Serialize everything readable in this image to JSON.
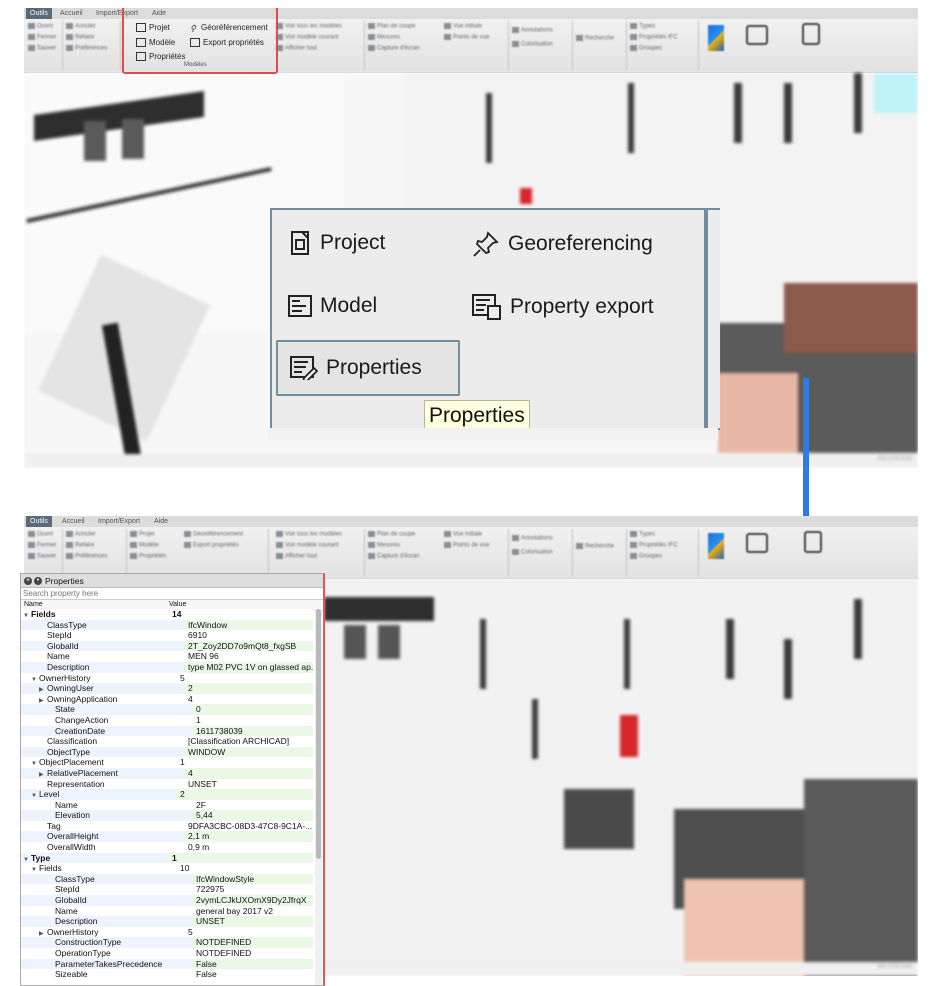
{
  "top_panel": {
    "tabs": [
      "Outils",
      "Accueil",
      "Import/Export",
      "Aide"
    ],
    "highlight_group": {
      "items": [
        "Projet",
        "Géoréférencement",
        "Modèle",
        "Export propriétés",
        "Propriétés"
      ],
      "group_label": "Modèles"
    }
  },
  "zoom": {
    "project": "Project",
    "georeferencing": "Georeferencing",
    "model": "Model",
    "property_export": "Property export",
    "properties": "Properties",
    "tooltip": "Properties"
  },
  "bottom_panel": {
    "tabs": [
      "Outils",
      "Accueil",
      "Import/Export",
      "Aide"
    ]
  },
  "properties_window": {
    "title": "Properties",
    "search_placeholder": "Search property here",
    "col_name": "Name",
    "col_value": "Value",
    "rows": [
      {
        "indent": 0,
        "toggle": "▼",
        "name": "Fields",
        "value": "14",
        "bold": true
      },
      {
        "indent": 2,
        "toggle": "",
        "name": "ClassType",
        "value": "IfcWindow"
      },
      {
        "indent": 2,
        "toggle": "",
        "name": "StepId",
        "value": "6910"
      },
      {
        "indent": 2,
        "toggle": "",
        "name": "GlobalId",
        "value": "2T_Zoy2DD7o9mQt8_fxgSB"
      },
      {
        "indent": 2,
        "toggle": "",
        "name": "Name",
        "value": "MEN 96"
      },
      {
        "indent": 2,
        "toggle": "",
        "name": "Description",
        "value": "type M02 PVC 1V on glassed ap..."
      },
      {
        "indent": 1,
        "toggle": "▼",
        "name": "OwnerHistory",
        "value": "5"
      },
      {
        "indent": 2,
        "toggle": "▶",
        "name": "OwningUser",
        "value": "2"
      },
      {
        "indent": 2,
        "toggle": "▶",
        "name": "OwningApplication",
        "value": "4"
      },
      {
        "indent": 3,
        "toggle": "",
        "name": "State",
        "value": "0"
      },
      {
        "indent": 3,
        "toggle": "",
        "name": "ChangeAction",
        "value": "1"
      },
      {
        "indent": 3,
        "toggle": "",
        "name": "CreationDate",
        "value": "1611738039"
      },
      {
        "indent": 2,
        "toggle": "",
        "name": "Classification",
        "value": "[Classification ARCHICAD]"
      },
      {
        "indent": 2,
        "toggle": "",
        "name": "ObjectType",
        "value": "WINDOW"
      },
      {
        "indent": 1,
        "toggle": "▼",
        "name": "ObjectPlacement",
        "value": "1"
      },
      {
        "indent": 2,
        "toggle": "▶",
        "name": "RelativePlacement",
        "value": "4"
      },
      {
        "indent": 2,
        "toggle": "",
        "name": "Representation",
        "value": "UNSET"
      },
      {
        "indent": 1,
        "toggle": "▼",
        "name": "Level",
        "value": "2"
      },
      {
        "indent": 3,
        "toggle": "",
        "name": "Name",
        "value": "2F"
      },
      {
        "indent": 3,
        "toggle": "",
        "name": "Elevation",
        "value": "5,44"
      },
      {
        "indent": 2,
        "toggle": "",
        "name": "Tag",
        "value": "9DFA3CBC-08D3-47C8-9C1A-..."
      },
      {
        "indent": 2,
        "toggle": "",
        "name": "OverallHeight",
        "value": "2,1 m"
      },
      {
        "indent": 2,
        "toggle": "",
        "name": "OverallWidth",
        "value": "0,9 m"
      },
      {
        "indent": 0,
        "toggle": "▼",
        "name": "Type",
        "value": "1",
        "bold": true
      },
      {
        "indent": 1,
        "toggle": "▼",
        "name": "Fields",
        "value": "10"
      },
      {
        "indent": 3,
        "toggle": "",
        "name": "ClassType",
        "value": "IfcWindowStyle"
      },
      {
        "indent": 3,
        "toggle": "",
        "name": "StepId",
        "value": "722975"
      },
      {
        "indent": 3,
        "toggle": "",
        "name": "GlobalId",
        "value": "2vymLCJkUXOmX9Dy2JfrqX"
      },
      {
        "indent": 3,
        "toggle": "",
        "name": "Name",
        "value": "general bay 2017 v2"
      },
      {
        "indent": 3,
        "toggle": "",
        "name": "Description",
        "value": "UNSET"
      },
      {
        "indent": 2,
        "toggle": "▶",
        "name": "OwnerHistory",
        "value": "5"
      },
      {
        "indent": 3,
        "toggle": "",
        "name": "ConstructionType",
        "value": "NOTDEFINED"
      },
      {
        "indent": 3,
        "toggle": "",
        "name": "OperationType",
        "value": "NOTDEFINED"
      },
      {
        "indent": 3,
        "toggle": "",
        "name": "ParameterTakesPrecedence",
        "value": "False"
      },
      {
        "indent": 3,
        "toggle": "",
        "name": "Sizeable",
        "value": "False"
      }
    ]
  },
  "colors": {
    "accent_blue": "#2f7be0",
    "highlight_red": "#e24b4b",
    "tooltip_bg": "#ffffe0",
    "name_row_alt": "#eef4ff",
    "value_row_alt": "#e9f9e6"
  }
}
